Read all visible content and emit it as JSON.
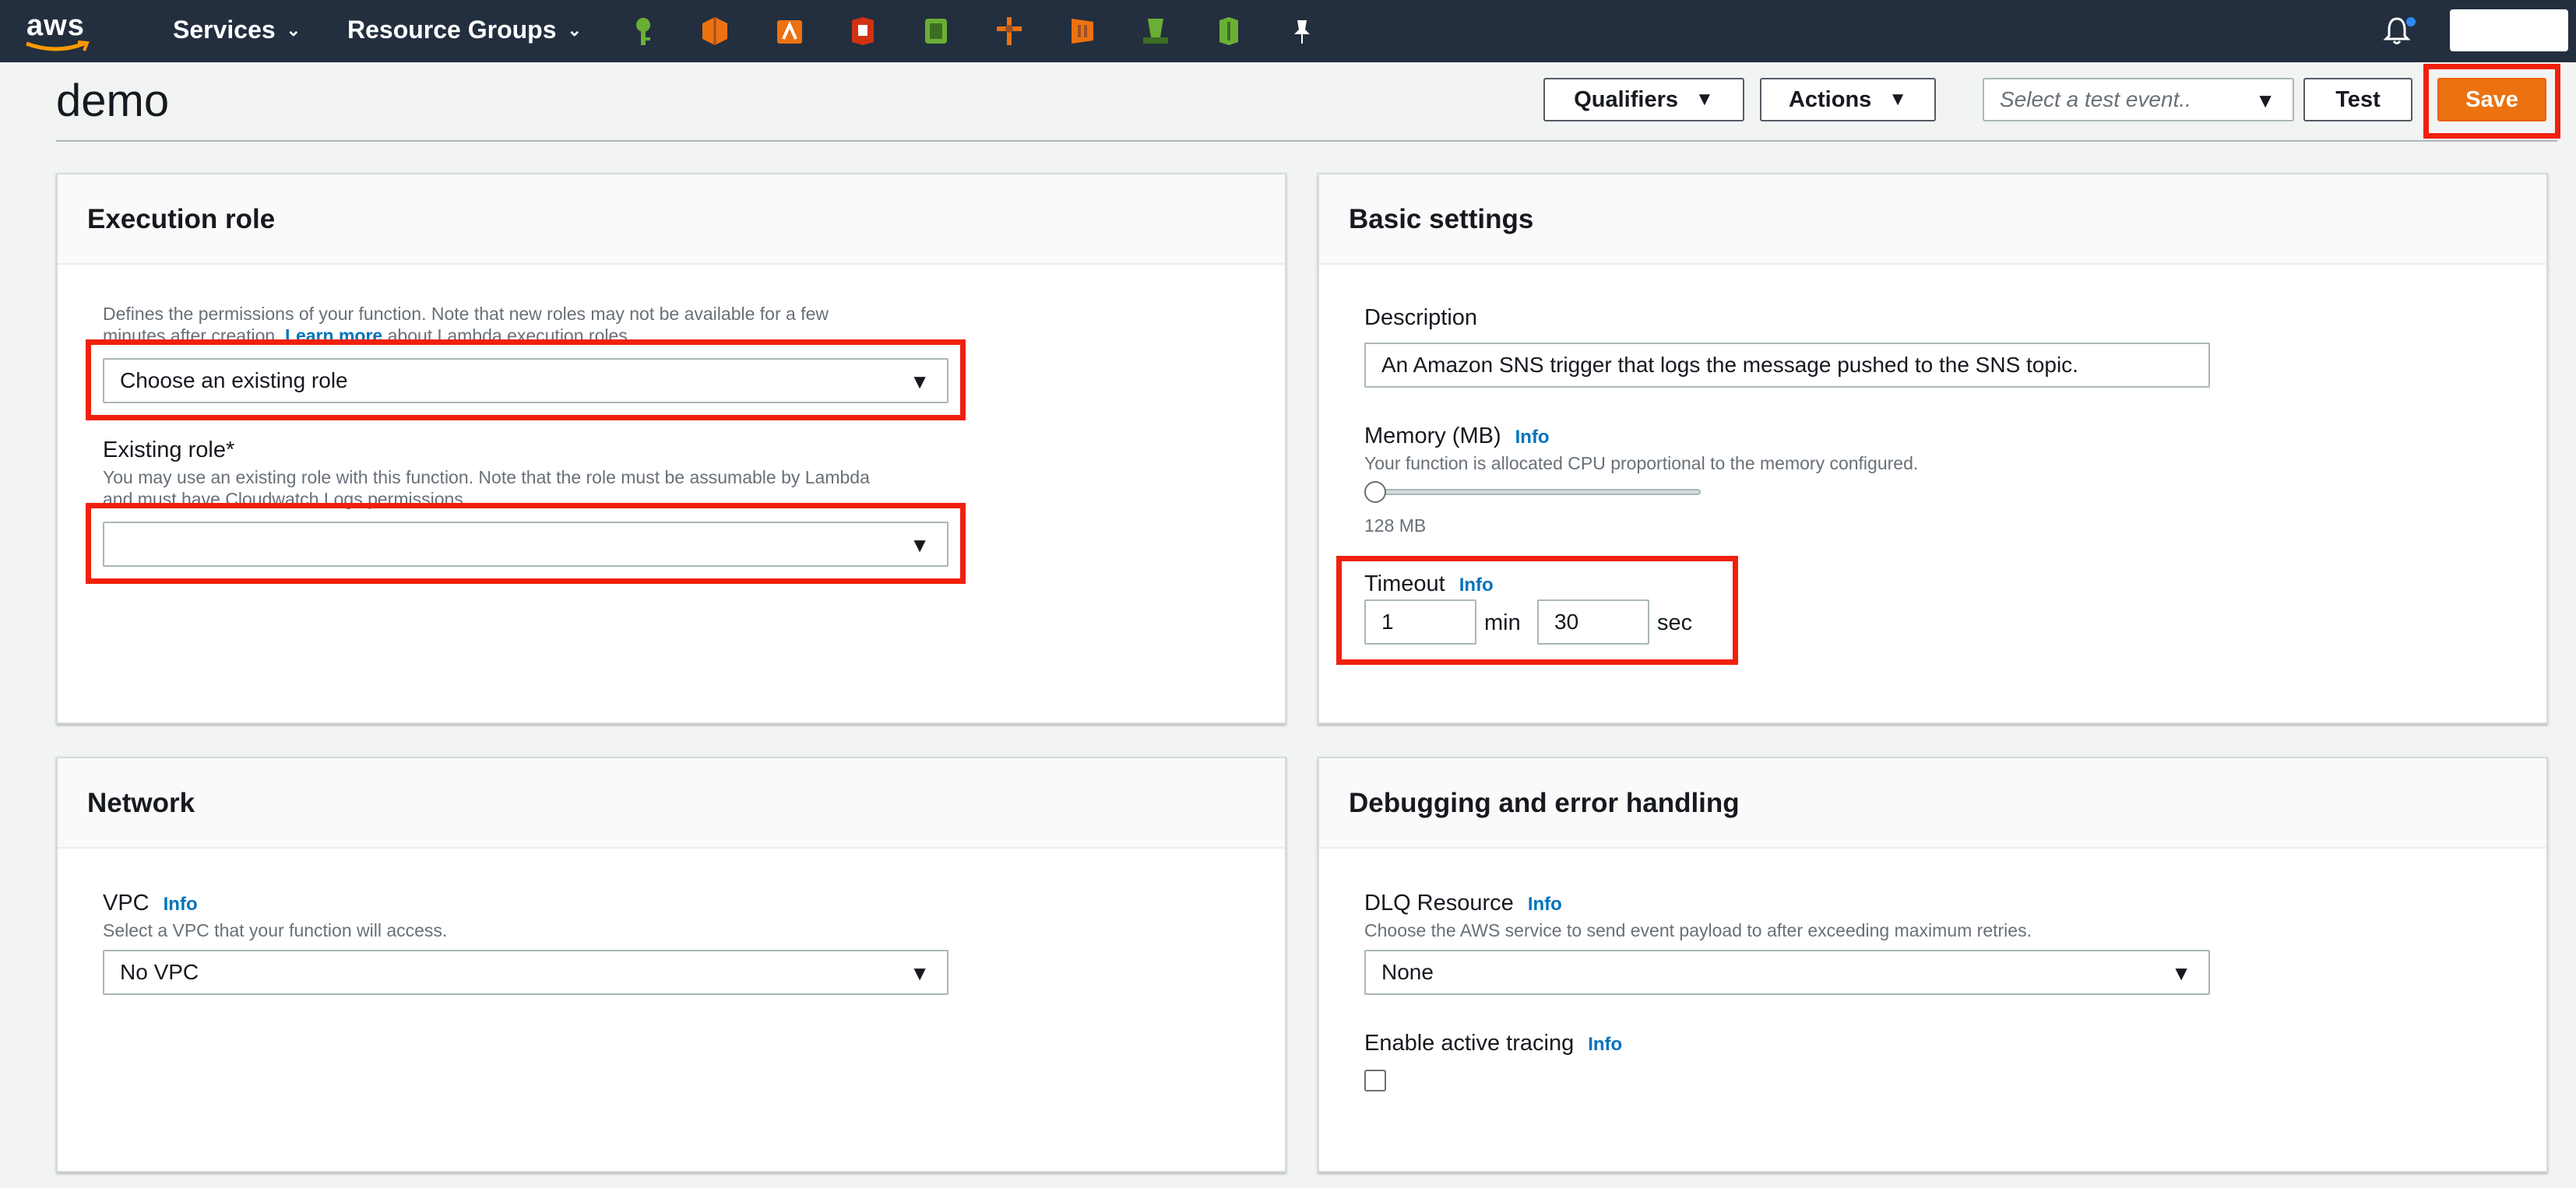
{
  "nav": {
    "logo_text": "aws",
    "services_label": "Services",
    "resource_groups_label": "Resource Groups",
    "service_icons": [
      {
        "name": "key-icon",
        "color": "#6aaf35"
      },
      {
        "name": "compute-icon",
        "color": "#ec7211"
      },
      {
        "name": "lambda-icon",
        "color": "#ec7211"
      },
      {
        "name": "storage-icon",
        "color": "#d13212"
      },
      {
        "name": "database-icon",
        "color": "#6aaf35"
      },
      {
        "name": "network-icon",
        "color": "#ec7211"
      },
      {
        "name": "container-icon",
        "color": "#ec7211"
      },
      {
        "name": "bucket-icon",
        "color": "#6aaf35"
      },
      {
        "name": "gateway-icon",
        "color": "#6aaf35"
      },
      {
        "name": "pin-icon",
        "color": "#ffffff"
      }
    ]
  },
  "header": {
    "function_name": "demo",
    "qualifiers_label": "Qualifiers",
    "actions_label": "Actions",
    "test_event_placeholder": "Select a test event..",
    "test_label": "Test",
    "save_label": "Save"
  },
  "execution_role": {
    "title": "Execution role",
    "help_line1": "Defines the permissions of your function. Note that new roles may not be available for a few",
    "help_line2_pre": "minutes after creation.",
    "help_link": "Learn more",
    "help_line2_post": "about Lambda execution roles.",
    "role_select_value": "Choose an existing role",
    "existing_role_label": "Existing role*",
    "existing_help_line1": "You may use an existing role with this function. Note that the role must be assumable by Lambda",
    "existing_help_line2": "and must have Cloudwatch Logs permissions.",
    "existing_role_value": ""
  },
  "basic_settings": {
    "title": "Basic settings",
    "description_label": "Description",
    "description_value": "An Amazon SNS trigger that logs the message pushed to the SNS topic.",
    "memory_label": "Memory (MB)",
    "memory_info": "Info",
    "memory_help": "Your function is allocated CPU proportional to the memory configured.",
    "memory_value_text": "128 MB",
    "memory_slider_fraction": 0.0,
    "timeout_label": "Timeout",
    "timeout_info": "Info",
    "timeout_min_value": "1",
    "timeout_min_unit": "min",
    "timeout_sec_value": "30",
    "timeout_sec_unit": "sec"
  },
  "network": {
    "title": "Network",
    "vpc_label": "VPC",
    "vpc_info": "Info",
    "vpc_help": "Select a VPC that your function will access.",
    "vpc_value": "No VPC"
  },
  "debugging": {
    "title": "Debugging and error handling",
    "dlq_label": "DLQ Resource",
    "dlq_info": "Info",
    "dlq_help": "Choose the AWS service to send event payload to after exceeding maximum retries.",
    "dlq_value": "None",
    "tracing_label": "Enable active tracing",
    "tracing_info": "Info",
    "tracing_checked": false
  },
  "colors": {
    "nav_bg": "#232f3e",
    "save_orange": "#ec7211",
    "link_blue": "#0073bb",
    "highlight_red": "#f0200c"
  }
}
